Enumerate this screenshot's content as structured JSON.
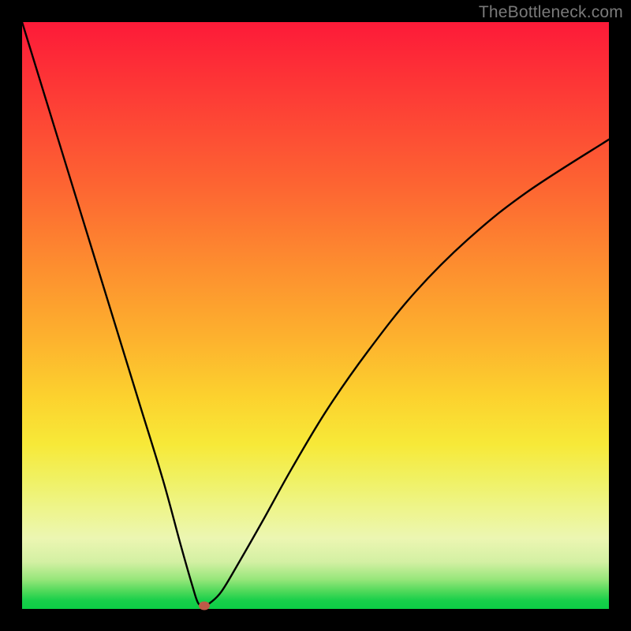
{
  "watermark": "TheBottleneck.com",
  "colors": {
    "background": "#000000",
    "curve": "#000000",
    "marker": "#be5a48"
  },
  "chart_data": {
    "type": "line",
    "title": "",
    "xlabel": "",
    "ylabel": "",
    "xlim": [
      0,
      100
    ],
    "ylim": [
      0,
      100
    ],
    "grid": false,
    "legend": false,
    "gradient_stops": [
      {
        "pos": 0,
        "color": "#fd1a38"
      },
      {
        "pos": 0.28,
        "color": "#fd6532"
      },
      {
        "pos": 0.54,
        "color": "#fdb22e"
      },
      {
        "pos": 0.72,
        "color": "#f7e938"
      },
      {
        "pos": 0.88,
        "color": "#ecf6b2"
      },
      {
        "pos": 0.97,
        "color": "#4fd95a"
      },
      {
        "pos": 1.0,
        "color": "#0ccd45"
      }
    ],
    "series": [
      {
        "name": "bottleneck-curve",
        "x": [
          0,
          4,
          8,
          12,
          16,
          20,
          24,
          27,
          29,
          30,
          31,
          32,
          34,
          37,
          41,
          46,
          52,
          59,
          67,
          76,
          86,
          100
        ],
        "values": [
          100,
          87,
          74,
          61,
          48,
          35,
          22,
          11,
          4,
          1,
          0.5,
          1,
          3,
          8,
          15,
          24,
          34,
          44,
          54,
          63,
          71,
          80
        ]
      }
    ],
    "annotations": [
      {
        "name": "optimum-marker",
        "x": 31,
        "y": 0.5,
        "color": "#be5a48"
      }
    ]
  }
}
